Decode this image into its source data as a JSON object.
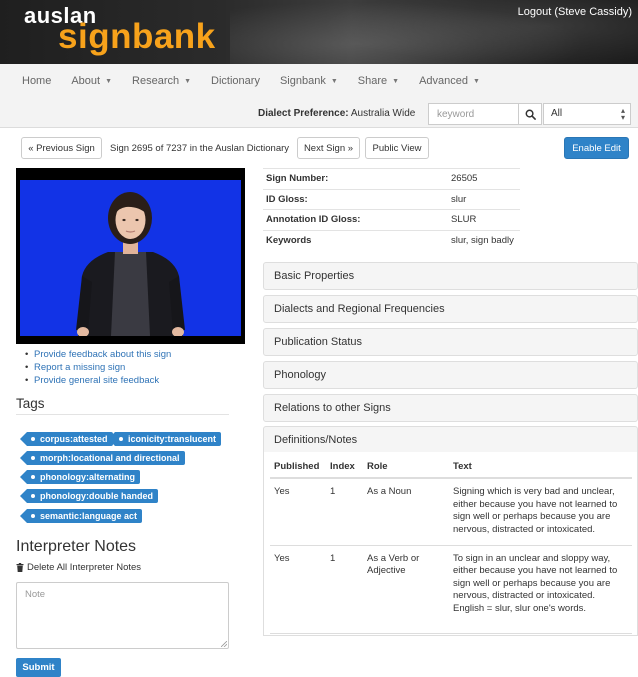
{
  "header": {
    "logo_top": "auslan",
    "logo_bottom": "signbank",
    "logout": "Logout (Steve Cassidy)"
  },
  "nav": {
    "items": [
      {
        "label": "Home",
        "has_caret": false
      },
      {
        "label": "About",
        "has_caret": true
      },
      {
        "label": "Research",
        "has_caret": true
      },
      {
        "label": "Dictionary",
        "has_caret": false
      },
      {
        "label": "Signbank",
        "has_caret": true
      },
      {
        "label": "Share",
        "has_caret": true
      },
      {
        "label": "Advanced",
        "has_caret": true
      }
    ],
    "dialect_label": "Dialect Preference:",
    "dialect_value": "Australia Wide",
    "search_placeholder": "keyword",
    "select_value": "All"
  },
  "toolbar": {
    "prev": "« Previous Sign",
    "count": "Sign 2695 of 7237 in the Auslan Dictionary",
    "next": "Next Sign »",
    "public_view": "Public View",
    "enable_edit": "Enable Edit"
  },
  "feedback_links": [
    "Provide feedback about this sign",
    "Report a missing sign",
    "Provide general site feedback"
  ],
  "tags": {
    "title": "Tags",
    "items": [
      "corpus:attested",
      "iconicity:translucent",
      "morph:locational and directional",
      "phonology:alternating",
      "phonology:double handed",
      "semantic:language act"
    ]
  },
  "interpreter": {
    "title": "Interpreter Notes",
    "delete_label": "Delete All Interpreter Notes",
    "note_placeholder": "Note",
    "submit": "Submit"
  },
  "info": [
    {
      "label": "Sign Number:",
      "value": "26505"
    },
    {
      "label": "ID Gloss:",
      "value": "slur"
    },
    {
      "label": "Annotation ID Gloss:",
      "value": "SLUR"
    },
    {
      "label": "Keywords",
      "value": "slur, sign badly"
    }
  ],
  "panels": [
    "Basic Properties",
    "Dialects and Regional Frequencies",
    "Publication Status",
    "Phonology",
    "Relations to other Signs",
    "Definitions/Notes"
  ],
  "definitions": {
    "headers": [
      "Published",
      "Index",
      "Role",
      "Text"
    ],
    "rows": [
      {
        "published": "Yes",
        "index": "1",
        "role": "As a Noun",
        "text": "Signing which is very bad and unclear, either because you have not learned to sign well or perhaps because you are nervous, distracted or intoxicated."
      },
      {
        "published": "Yes",
        "index": "1",
        "role": "As a Verb or Adjective",
        "text": "To sign in an unclear and sloppy way, either because you have not learned to sign well or perhaps because you are nervous, distracted or intoxicated. English = slur, slur one's words."
      }
    ]
  },
  "colors": {
    "brand_orange": "#f7a21b",
    "accent_blue": "#2f83c8",
    "link_blue": "#2f73b6",
    "video_bg": "#1233e6"
  }
}
